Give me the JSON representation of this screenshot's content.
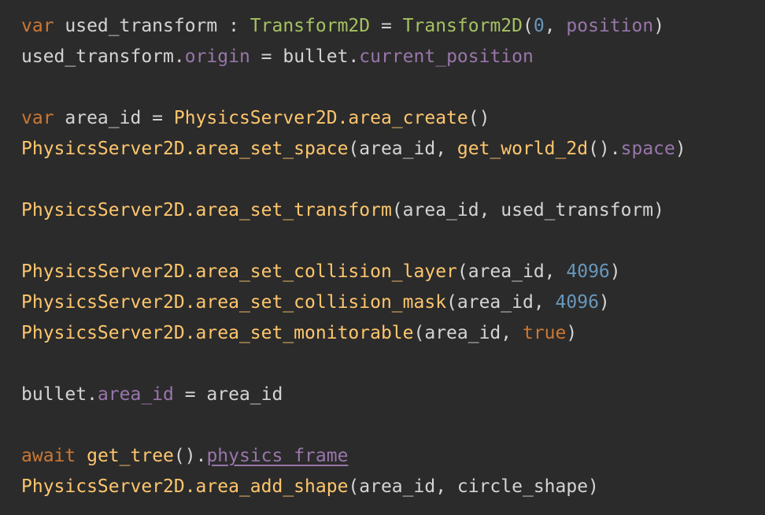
{
  "code": {
    "lines": [
      [
        {
          "t": "var",
          "k": "keyword"
        },
        {
          "t": " used_transform : ",
          "k": "plain"
        },
        {
          "t": "Transform2D",
          "k": "type"
        },
        {
          "t": " = ",
          "k": "plain"
        },
        {
          "t": "Transform2D",
          "k": "type"
        },
        {
          "t": "(",
          "k": "plain"
        },
        {
          "t": "0",
          "k": "number"
        },
        {
          "t": ", ",
          "k": "plain"
        },
        {
          "t": "position",
          "k": "member"
        },
        {
          "t": ")",
          "k": "plain"
        }
      ],
      [
        {
          "t": "used_transform.",
          "k": "plain"
        },
        {
          "t": "origin",
          "k": "member"
        },
        {
          "t": " = bullet.",
          "k": "plain"
        },
        {
          "t": "current_position",
          "k": "member"
        }
      ],
      [],
      [
        {
          "t": "var",
          "k": "keyword"
        },
        {
          "t": " area_id = ",
          "k": "plain"
        },
        {
          "t": "PhysicsServer2D.area_create",
          "k": "func"
        },
        {
          "t": "()",
          "k": "plain"
        }
      ],
      [
        {
          "t": "PhysicsServer2D.area_set_space",
          "k": "func"
        },
        {
          "t": "(area_id, ",
          "k": "plain"
        },
        {
          "t": "get_world_2d",
          "k": "func"
        },
        {
          "t": "().",
          "k": "plain"
        },
        {
          "t": "space",
          "k": "member"
        },
        {
          "t": ")",
          "k": "plain"
        }
      ],
      [],
      [
        {
          "t": "PhysicsServer2D.area_set_transform",
          "k": "func"
        },
        {
          "t": "(area_id, used_transform)",
          "k": "plain"
        }
      ],
      [],
      [
        {
          "t": "PhysicsServer2D.area_set_collision_layer",
          "k": "func"
        },
        {
          "t": "(area_id, ",
          "k": "plain"
        },
        {
          "t": "4096",
          "k": "number"
        },
        {
          "t": ")",
          "k": "plain"
        }
      ],
      [
        {
          "t": "PhysicsServer2D.area_set_collision_mask",
          "k": "func"
        },
        {
          "t": "(area_id, ",
          "k": "plain"
        },
        {
          "t": "4096",
          "k": "number"
        },
        {
          "t": ")",
          "k": "plain"
        }
      ],
      [
        {
          "t": "PhysicsServer2D.area_set_monitorable",
          "k": "func"
        },
        {
          "t": "(area_id, ",
          "k": "plain"
        },
        {
          "t": "true",
          "k": "keyword"
        },
        {
          "t": ")",
          "k": "plain"
        }
      ],
      [],
      [
        {
          "t": "bullet.",
          "k": "plain"
        },
        {
          "t": "area_id",
          "k": "member"
        },
        {
          "t": " = area_id",
          "k": "plain"
        }
      ],
      [],
      [
        {
          "t": "await",
          "k": "keyword"
        },
        {
          "t": " ",
          "k": "plain"
        },
        {
          "t": "get_tree",
          "k": "func"
        },
        {
          "t": "().",
          "k": "plain"
        },
        {
          "t": "physics_frame",
          "k": "member",
          "u": true
        }
      ],
      [
        {
          "t": "PhysicsServer2D.area_add_shape",
          "k": "func"
        },
        {
          "t": "(area_id, circle_shape)",
          "k": "plain"
        }
      ]
    ]
  },
  "colors": {
    "background": "#2b2b2b",
    "keyword": "#cc7832",
    "type": "#a5c261",
    "function": "#ffc66d",
    "member": "#9876aa",
    "number": "#6897bb",
    "plain": "#d4d4d4"
  }
}
